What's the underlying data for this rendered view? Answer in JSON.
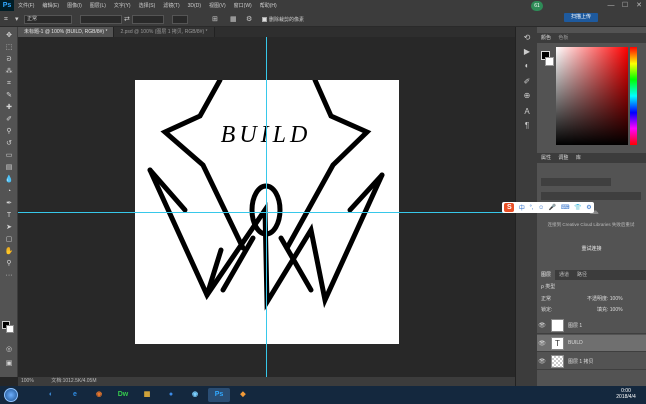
{
  "menubar": {
    "logo": "Ps",
    "items": [
      "文件(F)",
      "编辑(E)",
      "图像(I)",
      "图层(L)",
      "文字(Y)",
      "选择(S)",
      "滤镜(T)",
      "3D(D)",
      "视图(V)",
      "窗口(W)",
      "帮助(H)"
    ],
    "badge": "61",
    "minimize": "—",
    "maximize": "☐",
    "close": "✕"
  },
  "options": {
    "mode_value": "正常",
    "mode_label": "模式:",
    "opacity_label": "不透明度:",
    "opacity_value": "100%",
    "snap_label": "删除裁剪的像素",
    "share_button": "扫描上传"
  },
  "tabs": [
    {
      "label": "未标题-1 @ 100% (BUILD, RGB/8#) *",
      "active": true
    },
    {
      "label": "2.psd @ 100% (图层 1 拷贝, RGB/8#) *",
      "active": false
    }
  ],
  "artwork": {
    "text": "BUILD"
  },
  "status": {
    "zoom": "100%",
    "doc": "文档:1012.5K/4.05M"
  },
  "panels": {
    "color_tabs": [
      "颜色",
      "色板"
    ],
    "cc_tabs": [
      "属性",
      "调整",
      "库"
    ],
    "cc_message": "连接到 Creative Cloud Libraries 失败后重试",
    "cc_refresh": "重试连接",
    "layers_tabs": [
      "图层",
      "通道",
      "路径"
    ],
    "kind_label": "ρ 类型",
    "blend_mode": "正常",
    "opacity_label": "不透明度: 100%",
    "lock_label": "锁定:",
    "fill_label": "填充: 100%",
    "layers": [
      {
        "name": "图层 1",
        "type": "image",
        "selected": false
      },
      {
        "name": "BUILD",
        "type": "text",
        "selected": true
      },
      {
        "name": "图层 1 拷贝",
        "type": "checker",
        "selected": false
      }
    ]
  },
  "ime": {
    "logo": "S"
  },
  "taskbar": {
    "apps": [
      {
        "label": "◐",
        "color": "#3d8bd6"
      },
      {
        "label": "e",
        "color": "#2f8de4"
      },
      {
        "label": "◉",
        "color": "#e8762b"
      },
      {
        "label": "Dw",
        "color": "#35c94d"
      },
      {
        "label": "▦",
        "color": "#e6b23a"
      },
      {
        "label": "●",
        "color": "#3c8be8"
      },
      {
        "label": "◉",
        "color": "#7bd0ff"
      },
      {
        "label": "Ps",
        "color": "#31a8ff"
      },
      {
        "label": "◆",
        "color": "#f29a38"
      }
    ],
    "time": "0:00",
    "date": "2018/4/4"
  }
}
